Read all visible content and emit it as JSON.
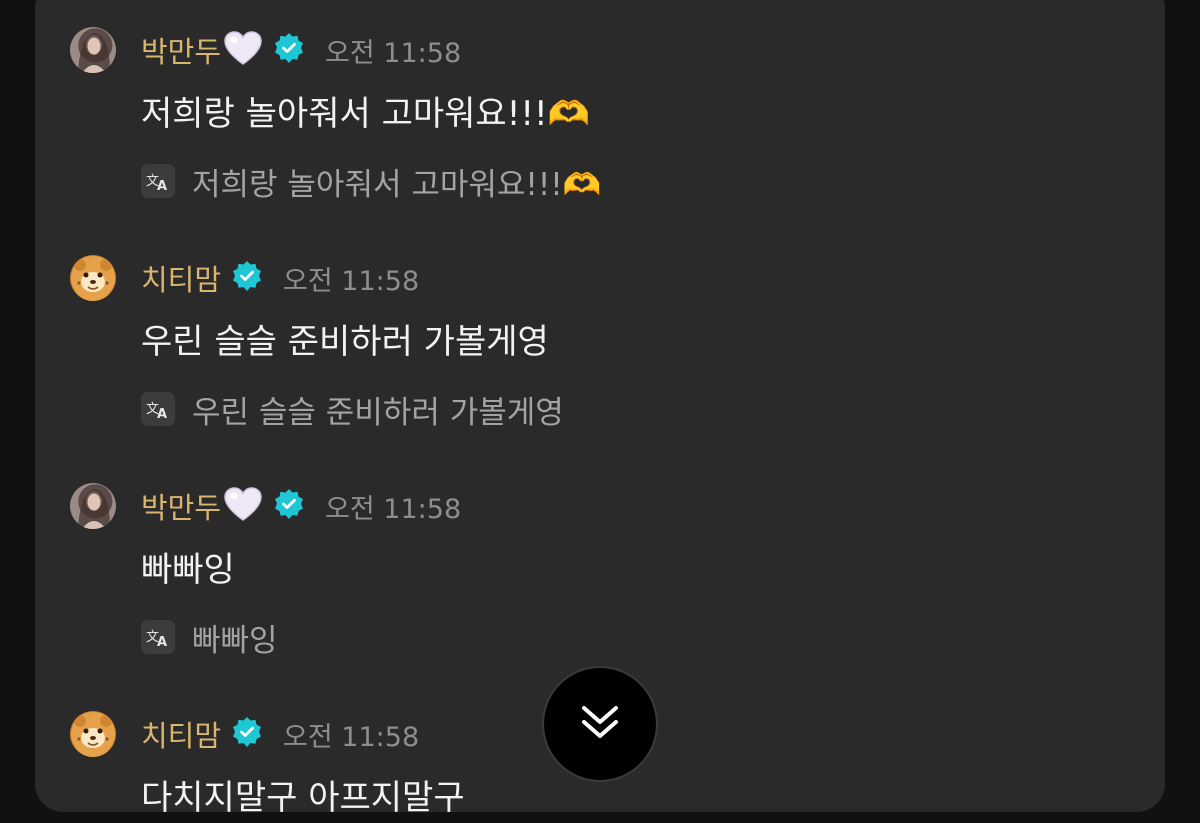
{
  "colors": {
    "username": "#d9b56e",
    "verified_badge": "#1fc7d4",
    "timestamp": "#8e8e8e",
    "message_text": "#f2f2f2",
    "translation_text": "#a3a3a3",
    "panel_background": "#2a2a2a"
  },
  "messages": [
    {
      "username": "박만두",
      "has_heart": true,
      "avatar": "person-avatar",
      "time": "오전 11:58",
      "text": "저희랑 놀아줘서 고마워요!!!🫶",
      "translation": "저희랑 놀아줘서 고마워요!!!🫶"
    },
    {
      "username": "치티맘",
      "has_heart": false,
      "avatar": "cheetah-avatar",
      "time": "오전 11:58",
      "text": "우린 슬슬 준비하러 가볼게영",
      "translation": "우린 슬슬 준비하러 가볼게영"
    },
    {
      "username": "박만두",
      "has_heart": true,
      "avatar": "person-avatar",
      "time": "오전 11:58",
      "text": "빠빠잉",
      "translation": "빠빠잉"
    },
    {
      "username": "치티맘",
      "has_heart": false,
      "avatar": "cheetah-avatar",
      "time": "오전 11:58",
      "text": "다치지말구 아프지말구",
      "translation": ""
    }
  ],
  "scroll_button": {
    "icon": "double-chevron-down-icon"
  }
}
